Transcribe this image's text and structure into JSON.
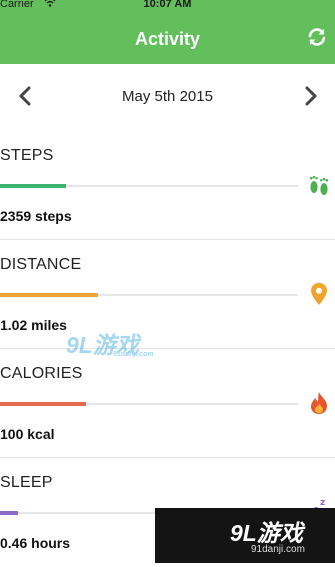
{
  "status_bar": {
    "carrier": "Carrier",
    "time": "10:07 AM"
  },
  "nav": {
    "title": "Activity",
    "refresh_icon": "refresh-icon"
  },
  "date_nav": {
    "date": "May 5th 2015"
  },
  "metrics": [
    {
      "label": "STEPS",
      "value": "2359 steps",
      "color": "#3cb36e",
      "progress": 0.22,
      "icon": "footprints-icon"
    },
    {
      "label": "DISTANCE",
      "value": "1.02 miles",
      "color": "#efa434",
      "progress": 0.33,
      "icon": "location-pin-icon"
    },
    {
      "label": "CALORIES",
      "value": "100 kcal",
      "color": "#e26a4d",
      "progress": 0.29,
      "icon": "flame-icon"
    },
    {
      "label": "SLEEP",
      "value": "0.46 hours",
      "color": "#8c6cc6",
      "progress": 0.06,
      "icon": "sleep-zz-icon"
    }
  ],
  "watermark": {
    "brand": "9L游戏",
    "url": "91danji.com"
  },
  "colors": {
    "header": "#62bf5c",
    "divider": "#e3e3e3"
  }
}
